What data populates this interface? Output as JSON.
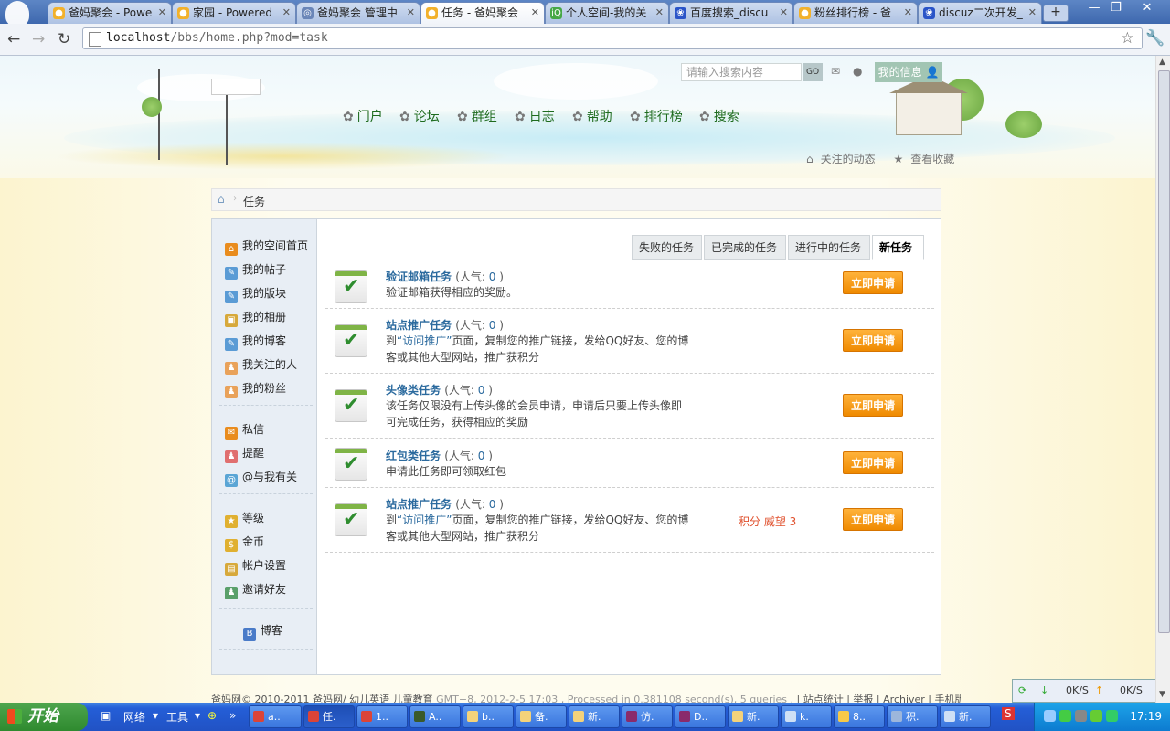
{
  "browser": {
    "tabs": [
      {
        "label": "爸妈聚会 - Powe",
        "active": false
      },
      {
        "label": "家园 - Powered",
        "active": false
      },
      {
        "label": "爸妈聚会 管理中",
        "active": false
      },
      {
        "label": "任务 - 爸妈聚会",
        "active": true
      },
      {
        "label": "个人空间-我的关",
        "active": false
      },
      {
        "label": "百度搜索_discu",
        "active": false
      },
      {
        "label": "粉丝排行榜 - 爸",
        "active": false
      },
      {
        "label": "discuz二次开发_",
        "active": false
      }
    ],
    "new_tab": "+",
    "url_host": "localhost",
    "url_path": "/bbs/home.php?mod=task",
    "window_controls": {
      "minimize": "—",
      "maximize": "❐",
      "close": "✕"
    }
  },
  "header": {
    "search_placeholder": "请输入搜索内容",
    "search_go": "GO",
    "my_info": "我的信息",
    "nav": [
      "门户",
      "论坛",
      "群组",
      "日志",
      "帮助",
      "排行榜",
      "搜索"
    ],
    "quick_links": [
      "关注的动态",
      "查看收藏"
    ]
  },
  "breadcrumb": {
    "current": "任务"
  },
  "sidebar": {
    "group1": [
      "我的空间首页",
      "我的帖子",
      "我的版块",
      "我的相册",
      "我的博客",
      "我关注的人",
      "我的粉丝"
    ],
    "group2": [
      "私信",
      "提醒",
      "@与我有关"
    ],
    "group3": [
      "等级",
      "金币",
      "帐户设置",
      "邀请好友"
    ],
    "group4": [
      "博客"
    ]
  },
  "task_tabs": [
    "失败的任务",
    "已完成的任务",
    "进行中的任务",
    "新任务"
  ],
  "active_task_tab": "新任务",
  "tasks": [
    {
      "name": "验证邮箱任务",
      "pop_label": "人气",
      "pop": "0",
      "desc_link": "",
      "desc": "验证邮箱获得相应的奖励。",
      "desc2": "",
      "reward": "",
      "button": "立即申请"
    },
    {
      "name": "站点推广任务",
      "pop_label": "人气",
      "pop": "0",
      "desc_link": "“访问推广”",
      "desc_prefix": "到",
      "desc": "页面，复制您的推广链接，发给QQ好友、您的博",
      "desc2": "客或其他大型网站，推广获积分",
      "reward": "",
      "button": "立即申请"
    },
    {
      "name": "头像类任务",
      "pop_label": "人气",
      "pop": "0",
      "desc_link": "",
      "desc": "该任务仅限没有上传头像的会员申请，申请后只要上传头像即",
      "desc2": "可完成任务，获得相应的奖励",
      "reward": "",
      "button": "立即申请"
    },
    {
      "name": "红包类任务",
      "pop_label": "人气",
      "pop": "0",
      "desc_link": "",
      "desc": "申请此任务即可领取红包",
      "desc2": "",
      "reward": "",
      "button": "立即申请"
    },
    {
      "name": "站点推广任务",
      "pop_label": "人气",
      "pop": "0",
      "desc_link": "“访问推广”",
      "desc_prefix": "到",
      "desc": "页面，复制您的推广链接，发给QQ好友、您的博",
      "desc2": "客或其他大型网站，推广获积分",
      "reward": "积分 威望 3",
      "button": "立即申请"
    }
  ],
  "footer": {
    "left": "爸妈网© 2010-2011 爸妈网/ 幼儿英语 儿童教育",
    "meta": "GMT+8, 2012-2-5 17:03 , Processed in 0.381108 second(s), 5 queries .",
    "links": "| 站点统计 | 举报 | Archiver | 手机版"
  },
  "net_monitor": {
    "down": "0K/S",
    "up": "0K/S"
  },
  "taskbar": {
    "start": "开始",
    "quick_launch": [
      "网络",
      "工具"
    ],
    "buttons": [
      "a..",
      "任.",
      "1..",
      "A..",
      "b..",
      "备.",
      "新.",
      "仿.",
      "D..",
      "新.",
      "k.",
      "8..",
      "积.",
      "新."
    ],
    "clock": "17:19"
  },
  "colors": {
    "accent_orange": "#ef8a00",
    "link_blue": "#2b6a9e",
    "nav_green": "#1e6b1e",
    "reward_red": "#e0502d"
  }
}
